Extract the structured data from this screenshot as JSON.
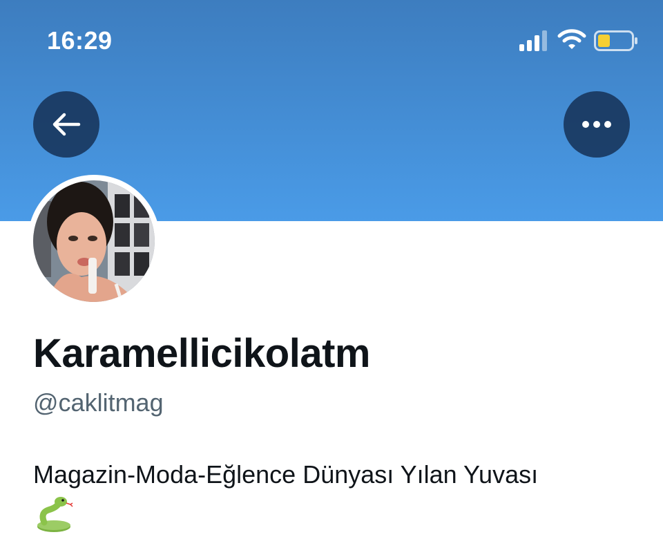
{
  "status_bar": {
    "time": "16:29",
    "icons": [
      "signal-icon",
      "wifi-icon",
      "battery-icon"
    ],
    "battery_color": "#f5cf33"
  },
  "header": {
    "banner_color": "#4a9be7",
    "back_icon": "arrow-left-icon",
    "more_icon": "ellipsis-icon"
  },
  "profile": {
    "display_name": "Karamellicikolatm",
    "handle": "@caklitmag",
    "bio": "Magazin-Moda-Eğlence Dünyası Yılan Yuvası",
    "bio_emoji": "snake-emoji"
  }
}
